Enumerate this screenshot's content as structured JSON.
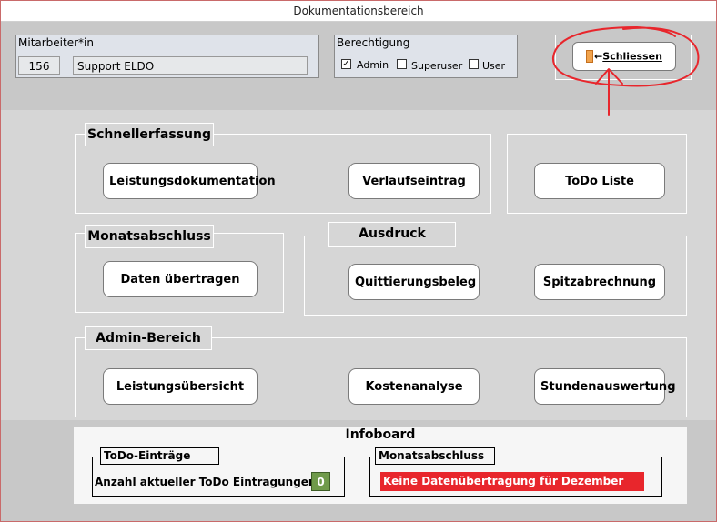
{
  "window": {
    "title": "Dokumentationsbereich"
  },
  "employee": {
    "label": "Mitarbeiter*in",
    "id": "156",
    "name": "Support ELDO"
  },
  "permission": {
    "label": "Berechtigung",
    "options": [
      {
        "label": "Admin",
        "checked": true
      },
      {
        "label": "Superuser",
        "checked": false
      },
      {
        "label": "User",
        "checked": false
      }
    ]
  },
  "close_button": {
    "label": "Schliessen",
    "icon": "exit-door-icon"
  },
  "annotation": {
    "color": "#e8262c"
  },
  "groups": {
    "schnellerfassung": {
      "title": "Schnellerfassung",
      "buttons": [
        "Leistungsdokumentation",
        "Verlaufseintrag"
      ]
    },
    "todo": {
      "buttons": [
        "ToDo Liste"
      ]
    },
    "monatsabschluss": {
      "title": "Monatsabschluss",
      "buttons": [
        "Daten übertragen"
      ]
    },
    "ausdruck": {
      "title": "Ausdruck",
      "buttons": [
        "Quittierungsbeleg",
        "Spitzabrechnung"
      ]
    },
    "admin": {
      "title": "Admin-Bereich",
      "buttons": [
        "Leistungsübersicht",
        "Kostenanalyse",
        "Stundenauswertung"
      ]
    }
  },
  "infoboard": {
    "title": "Infoboard",
    "todo": {
      "title": "ToDo-Einträge",
      "text": "Anzahl aktueller ToDo Eintragungen",
      "count": "0"
    },
    "month": {
      "title": "Monatsabschluss",
      "alert": "Keine Datenübertragung für Dezember",
      "alert_color": "#e8262c"
    }
  }
}
